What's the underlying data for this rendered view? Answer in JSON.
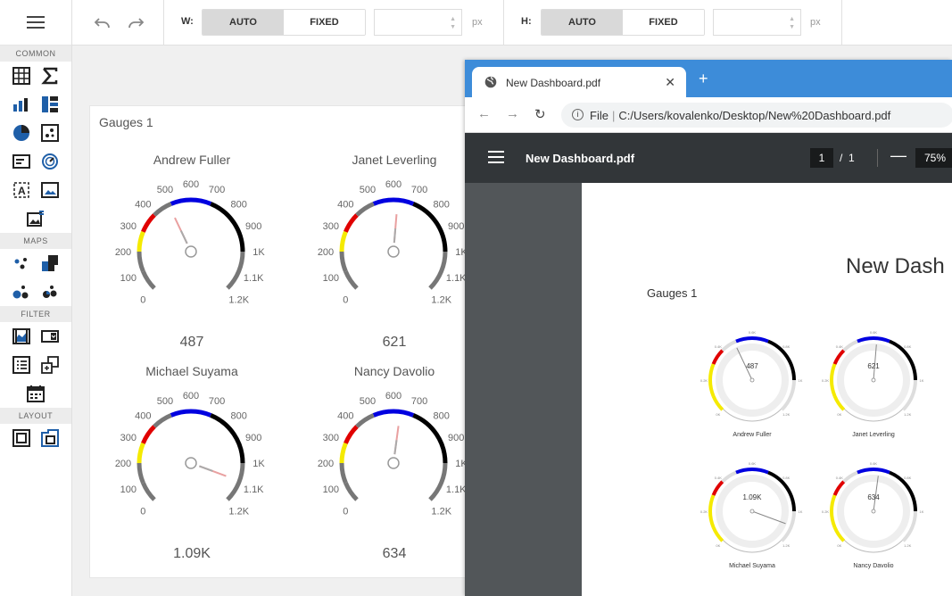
{
  "toolbox": {
    "sections": [
      "COMMON",
      "MAPS",
      "FILTER",
      "LAYOUT"
    ]
  },
  "toolbar": {
    "width_label": "W:",
    "height_label": "H:",
    "auto_label": "AUTO",
    "fixed_label": "FIXED",
    "unit": "px"
  },
  "dashboard": {
    "group_title": "Gauges 1",
    "gauges": [
      {
        "name": "Andrew Fuller",
        "value_label": "487",
        "value": 487
      },
      {
        "name": "Janet Leverling",
        "value_label": "621",
        "value": 621
      },
      {
        "name": "Michael Suyama",
        "value_label": "1.09K",
        "value": 1090
      },
      {
        "name": "Nancy Davolio",
        "value_label": "634",
        "value": 634
      }
    ],
    "scale_ticks": [
      "0",
      "100",
      "200",
      "300",
      "400",
      "500",
      "600",
      "700",
      "800",
      "900",
      "1K",
      "1.1K",
      "1.2K"
    ],
    "colors": {
      "red": "#e00000",
      "yellow": "#f5ea00",
      "blue": "#0000e0",
      "black": "#000000",
      "gray": "#777777"
    }
  },
  "browser": {
    "tab_title": "New Dashboard.pdf",
    "new_tab": "+",
    "address_prefix": "File",
    "address_url": "C:/Users/kovalenko/Desktop/New%20Dashboard.pdf",
    "pdf_title": "New Dashboard.pdf",
    "page_current": "1",
    "page_sep": "/",
    "page_total": "1",
    "zoom": "75%",
    "accent": "#3d8cd9"
  },
  "pdf": {
    "heading": "New Dash",
    "group_title": "Gauges 1",
    "mini_gauges": [
      {
        "name": "Andrew Fuller",
        "value_label": "487",
        "value": 487
      },
      {
        "name": "Janet Leverling",
        "value_label": "621",
        "value": 621
      },
      {
        "name": "Michael Suyama",
        "value_label": "1.09K",
        "value": 1090
      },
      {
        "name": "Nancy Davolio",
        "value_label": "634",
        "value": 634
      }
    ],
    "mini_ticks": [
      "0K",
      "0.2K",
      "0.4K",
      "0.6K",
      "0.8K",
      "1K",
      "1.2K"
    ]
  }
}
